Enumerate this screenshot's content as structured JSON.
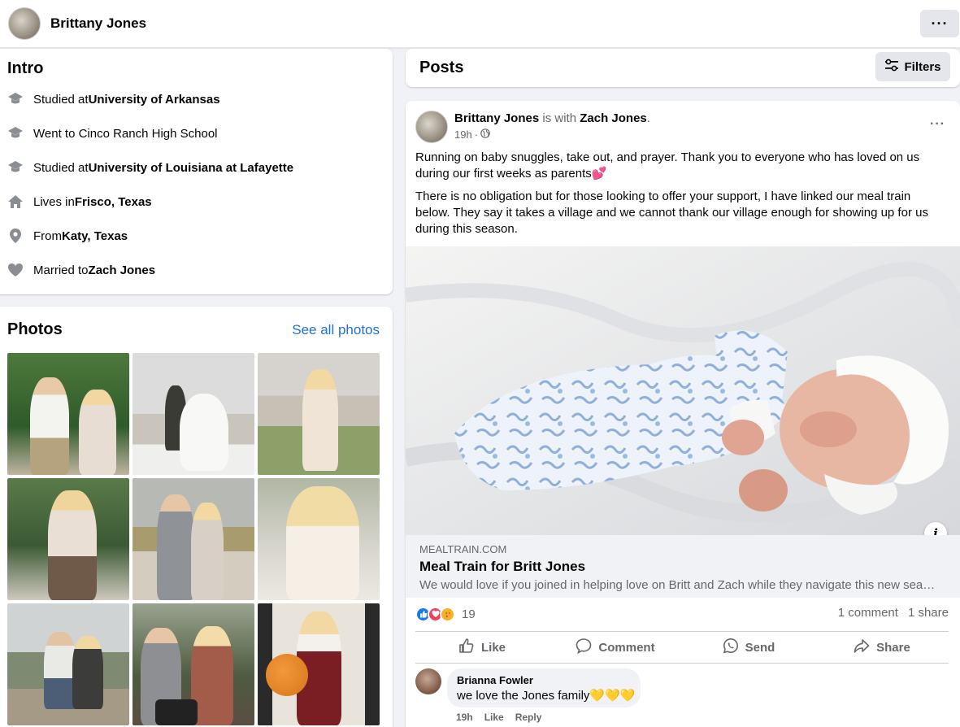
{
  "header": {
    "profile_name": "Brittany Jones",
    "more_label": "···"
  },
  "intro": {
    "title": "Intro",
    "items": [
      {
        "icon": "graduation-cap-icon",
        "prefix": "Studied at ",
        "value": "University of Arkansas"
      },
      {
        "icon": "graduation-cap-icon",
        "prefix": "Went to Cinco Ranch High School",
        "value": ""
      },
      {
        "icon": "graduation-cap-icon",
        "prefix": "Studied at ",
        "value": "University of Louisiana at Lafayette"
      },
      {
        "icon": "home-icon",
        "prefix": "Lives in ",
        "value": "Frisco, Texas"
      },
      {
        "icon": "location-pin-icon",
        "prefix": "From ",
        "value": "Katy, Texas"
      },
      {
        "icon": "heart-icon",
        "prefix": "Married to ",
        "value": "Zach Jones"
      }
    ]
  },
  "photos": {
    "title": "Photos",
    "see_all": "See all photos"
  },
  "posts": {
    "title": "Posts",
    "filters_label": "Filters"
  },
  "post": {
    "author": "Brittany Jones",
    "with_text": " is with ",
    "tagged": "Zach Jones",
    "time": "19h",
    "separator": "·",
    "more_label": "···",
    "paragraph1": "Running on baby snuggles, take out, and prayer. Thank you to everyone who has loved on us during our first weeks as parents💕",
    "paragraph2": "There is no obligation but for those looking to offer your support, I have linked our meal train below. They say it takes a village and we cannot thank our village enough for showing up for us during this season.",
    "info_label": "i",
    "link": {
      "domain": "MEALTRAIN.COM",
      "title": "Meal Train for Britt Jones",
      "description": "We would love if you joined in helping love on Britt and Zach while they navigate this new sea…"
    },
    "reaction_count": "19",
    "comment_count": "1 comment",
    "share_count": "1 share",
    "actions": {
      "like": "Like",
      "comment": "Comment",
      "send": "Send",
      "share": "Share"
    },
    "comment": {
      "name": "Brianna Fowler",
      "text": "we love the Jones family💛💛💛",
      "time": "19h",
      "like": "Like",
      "reply": "Reply"
    }
  },
  "colors": {
    "link_blue": "#216fdb",
    "like_blue": "#1877f2",
    "love_red": "#f33e58",
    "care_yellow": "#f7b125"
  }
}
